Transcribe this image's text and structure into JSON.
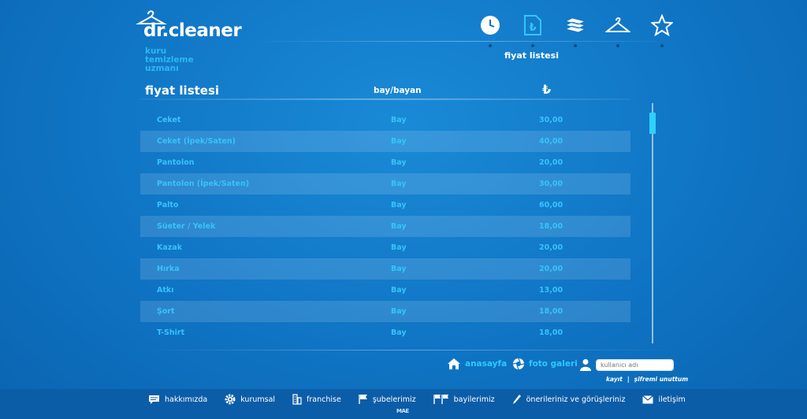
{
  "brand": {
    "name": "dr.cleaner",
    "tagline": [
      "kuru",
      "temizleme",
      "uzmanı"
    ]
  },
  "top_nav": {
    "icons": [
      "clock-icon",
      "price-tag-icon",
      "clothes-stack-icon",
      "hanger-icon",
      "star-icon"
    ],
    "active": "price-tag-icon"
  },
  "section_title": "fiyat listesi",
  "table": {
    "title": "fiyat listesi",
    "gender_header": "bay/bayan",
    "currency_symbol": "₺",
    "rows": [
      {
        "name": "Ceket",
        "gender": "Bay",
        "price": "30,00"
      },
      {
        "name": "Ceket (İpek/Saten)",
        "gender": "Bay",
        "price": "40,00"
      },
      {
        "name": "Pantolon",
        "gender": "Bay",
        "price": "20,00"
      },
      {
        "name": "Pantolon (İpek/Saten)",
        "gender": "Bay",
        "price": "30,00"
      },
      {
        "name": "Palto",
        "gender": "Bay",
        "price": "60,00"
      },
      {
        "name": "Süeter / Yelek",
        "gender": "Bay",
        "price": "18,00"
      },
      {
        "name": "Kazak",
        "gender": "Bay",
        "price": "20,00"
      },
      {
        "name": "Hırka",
        "gender": "Bay",
        "price": "20,00"
      },
      {
        "name": "Atkı",
        "gender": "Bay",
        "price": "13,00"
      },
      {
        "name": "Şort",
        "gender": "Bay",
        "price": "18,00"
      },
      {
        "name": "T-Shirt",
        "gender": "Bay",
        "price": "18,00"
      }
    ]
  },
  "quick_links": {
    "home": "anasayfa",
    "gallery": "foto galeri"
  },
  "login": {
    "username_placeholder": "kullanıcı adı",
    "register": "kayıt",
    "separator": "|",
    "forgot": "şifremi unuttum"
  },
  "footer": {
    "items": [
      {
        "label": "hakkımızda",
        "icon": "speech-bubble-icon"
      },
      {
        "label": "kurumsal",
        "icon": "gear-icon"
      },
      {
        "label": "franchise",
        "icon": "building-icon"
      },
      {
        "label": "şubelerimiz",
        "icon": "flag-icon"
      },
      {
        "label": "bayilerimiz",
        "icon": "flags-icon"
      },
      {
        "label": "önerileriniz ve görüşleriniz",
        "icon": "pen-icon"
      },
      {
        "label": "iletişim",
        "icon": "envelope-icon"
      }
    ],
    "credit": "MAE"
  },
  "colors": {
    "background": "#1280cc",
    "accent": "#36c4fb",
    "footer": "#0b5da8"
  }
}
